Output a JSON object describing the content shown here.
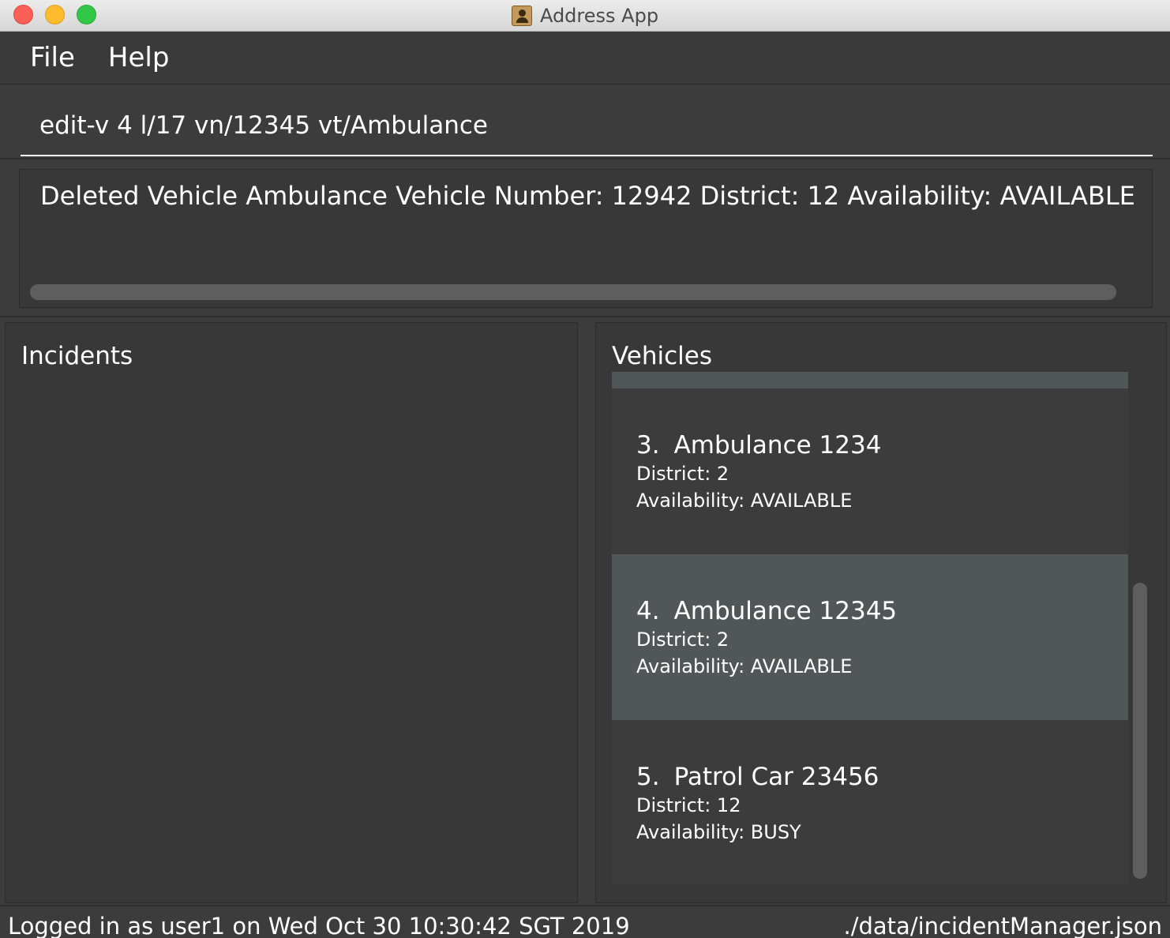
{
  "window": {
    "title": "Address App"
  },
  "menu": {
    "file": "File",
    "help": "Help"
  },
  "command_box": {
    "value": "edit-v 4 l/17 vn/12345 vt/Ambulance"
  },
  "result_display": {
    "text": "Deleted Vehicle Ambulance Vehicle Number: 12942 District: 12 Availability: AVAILABLE"
  },
  "incidents_panel": {
    "title": "Incidents"
  },
  "vehicles_panel": {
    "title": "Vehicles",
    "items": [
      {
        "index": "3.",
        "name": "Ambulance 1234",
        "district": "District: 2",
        "availability": "Availability: AVAILABLE",
        "selected": false
      },
      {
        "index": "4.",
        "name": "Ambulance 12345",
        "district": "District: 2",
        "availability": "Availability: AVAILABLE",
        "selected": true
      },
      {
        "index": "5.",
        "name": "Patrol Car 23456",
        "district": "District: 12",
        "availability": "Availability: BUSY",
        "selected": false
      }
    ]
  },
  "status_bar": {
    "left": "Logged in as user1 on Wed Oct 30 10:30:42 SGT 2019",
    "right": "./data/incidentManager.json"
  },
  "colors": {
    "background": "#3c3c3c",
    "selected_card": "#515658",
    "text": "#ffffff"
  }
}
